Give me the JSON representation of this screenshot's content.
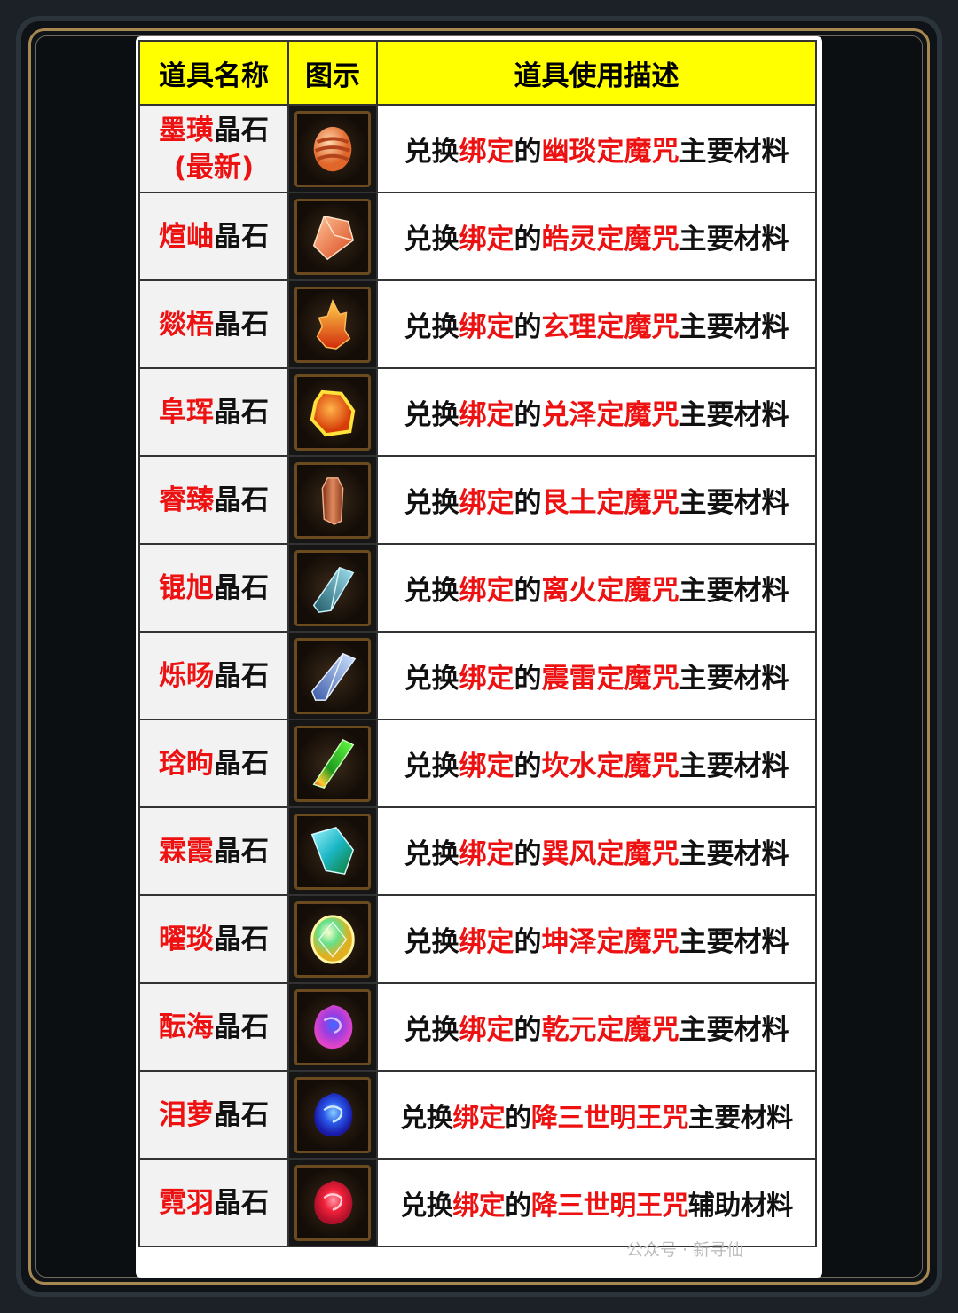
{
  "headers": {
    "name": "道具名称",
    "icon": "图示",
    "desc": "道具使用描述"
  },
  "desc_parts": {
    "prefix": "兑换",
    "bound": "绑定",
    "of": "的"
  },
  "colors": {
    "header_bg": "#ffff00",
    "highlight": "#ee1111",
    "gold_border": "#a78850"
  },
  "rows": [
    {
      "name_hl": "墨璜",
      "name_suffix": "晶石",
      "tag": "(最新)",
      "spell": "幽琰定魔咒",
      "tail": "主要材料",
      "icon": "striped-orange-orb-icon"
    },
    {
      "name_hl": "煊岫",
      "name_suffix": "晶石",
      "tag": "",
      "spell": "皓灵定魔咒",
      "tail": "主要材料",
      "icon": "orange-crystal-icon"
    },
    {
      "name_hl": "燚梧",
      "name_suffix": "晶石",
      "tag": "",
      "spell": "玄理定魔咒",
      "tail": "主要材料",
      "icon": "flame-crystal-icon"
    },
    {
      "name_hl": "阜珲",
      "name_suffix": "晶石",
      "tag": "",
      "spell": "兑泽定魔咒",
      "tail": "主要材料",
      "icon": "amber-rock-icon"
    },
    {
      "name_hl": "睿臻",
      "name_suffix": "晶石",
      "tag": "",
      "spell": "艮土定魔咒",
      "tail": "主要材料",
      "icon": "brown-shard-icon"
    },
    {
      "name_hl": "锟旭",
      "name_suffix": "晶石",
      "tag": "",
      "spell": "离火定魔咒",
      "tail": "主要材料",
      "icon": "teal-shard-icon"
    },
    {
      "name_hl": "烁旸",
      "name_suffix": "晶石",
      "tag": "",
      "spell": "震雷定魔咒",
      "tail": "主要材料",
      "icon": "blue-shard-icon"
    },
    {
      "name_hl": "琀昫",
      "name_suffix": "晶石",
      "tag": "",
      "spell": "坎水定魔咒",
      "tail": "主要材料",
      "icon": "green-red-crystal-icon"
    },
    {
      "name_hl": "霖霞",
      "name_suffix": "晶石",
      "tag": "",
      "spell": "巽风定魔咒",
      "tail": "主要材料",
      "icon": "cyan-green-gem-icon"
    },
    {
      "name_hl": "曜琰",
      "name_suffix": "晶石",
      "tag": "",
      "spell": "坤泽定魔咒",
      "tail": "主要材料",
      "icon": "prismatic-oval-gem-icon"
    },
    {
      "name_hl": "酝海",
      "name_suffix": "晶石",
      "tag": "",
      "spell": "乾元定魔咒",
      "tail": "主要材料",
      "icon": "purple-swirl-gem-icon"
    },
    {
      "name_hl": "泪萝",
      "name_suffix": "晶石",
      "tag": "",
      "spell": "降三世明王咒",
      "tail": "主要材料",
      "icon": "blue-swirl-gem-icon"
    },
    {
      "name_hl": "霓羽",
      "name_suffix": "晶石",
      "tag": "",
      "spell": "降三世明王咒",
      "tail": "辅助材料",
      "icon": "red-swirl-gem-icon"
    }
  ],
  "watermark": "公众号 · 新寻仙"
}
